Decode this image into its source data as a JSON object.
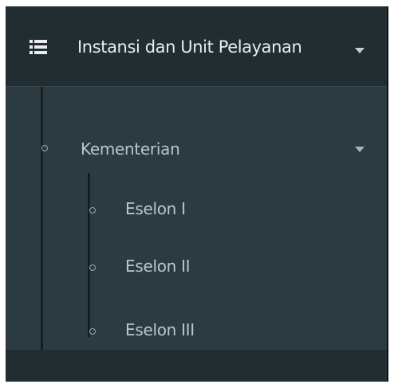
{
  "sidebar": {
    "header": {
      "title": "Instansi dan Unit Pelayanan",
      "icon": "list-icon",
      "expanded": true
    },
    "menu": {
      "label": "Kementerian",
      "expanded": true,
      "items": [
        {
          "label": "Eselon I"
        },
        {
          "label": "Eselon II"
        },
        {
          "label": "Eselon III"
        }
      ]
    }
  },
  "colors": {
    "header_bg": "#222d32",
    "menu_bg": "#2c3b41",
    "text": "#b8c7ce",
    "title_text": "#e8ecee"
  }
}
